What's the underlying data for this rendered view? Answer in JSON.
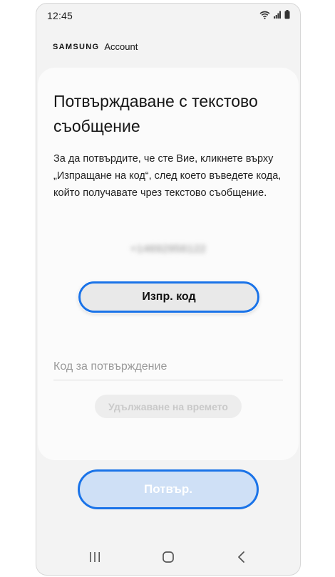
{
  "status_bar": {
    "time": "12:45",
    "icons": [
      "wifi-icon",
      "signal-icon",
      "battery-icon"
    ]
  },
  "brand": {
    "samsung": "SAMSUNG",
    "account": "Account"
  },
  "card": {
    "title": "Потвърждаване с текстово съобщение",
    "description": "За да потвърдите, че сте Вие, кликнете върху „Изпращане на код“, след което въведете кода, който получавате чрез текстово съобщение.",
    "phone_number": "+14692956122",
    "send_code_label": "Изпр. код",
    "code_placeholder": "Код за потвърждение",
    "extend_time_label": "Удължаване на времето"
  },
  "confirm_label": "Потвър.",
  "nav": {
    "icons": [
      "recent-apps-icon",
      "home-icon",
      "back-icon"
    ]
  },
  "colors": {
    "accent": "#1a73e8",
    "background": "#f3f3f3",
    "card": "#fbfbfb",
    "confirm_fill": "#cfe0f6"
  }
}
